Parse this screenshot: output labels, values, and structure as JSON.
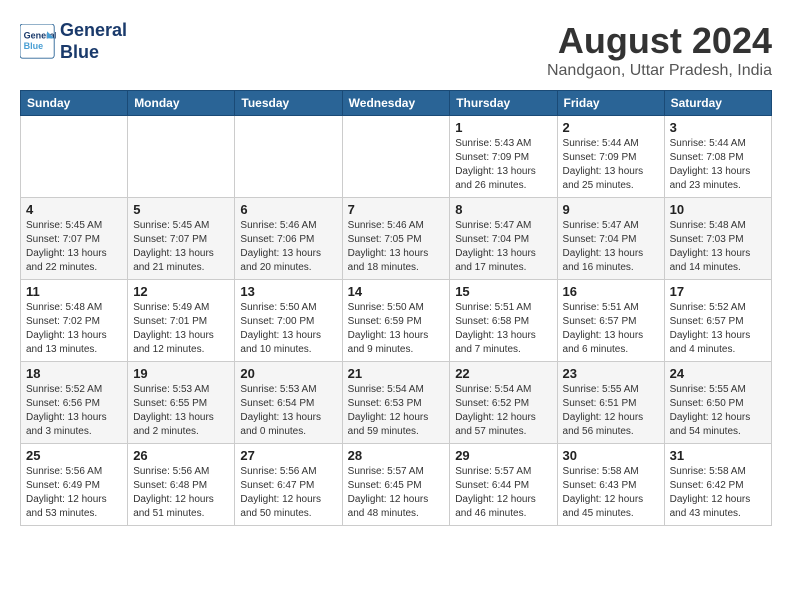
{
  "header": {
    "logo_line1": "General",
    "logo_line2": "Blue",
    "month_year": "August 2024",
    "location": "Nandgaon, Uttar Pradesh, India"
  },
  "weekdays": [
    "Sunday",
    "Monday",
    "Tuesday",
    "Wednesday",
    "Thursday",
    "Friday",
    "Saturday"
  ],
  "weeks": [
    [
      {
        "day": "",
        "info": ""
      },
      {
        "day": "",
        "info": ""
      },
      {
        "day": "",
        "info": ""
      },
      {
        "day": "",
        "info": ""
      },
      {
        "day": "1",
        "info": "Sunrise: 5:43 AM\nSunset: 7:09 PM\nDaylight: 13 hours and 26 minutes."
      },
      {
        "day": "2",
        "info": "Sunrise: 5:44 AM\nSunset: 7:09 PM\nDaylight: 13 hours and 25 minutes."
      },
      {
        "day": "3",
        "info": "Sunrise: 5:44 AM\nSunset: 7:08 PM\nDaylight: 13 hours and 23 minutes."
      }
    ],
    [
      {
        "day": "4",
        "info": "Sunrise: 5:45 AM\nSunset: 7:07 PM\nDaylight: 13 hours and 22 minutes."
      },
      {
        "day": "5",
        "info": "Sunrise: 5:45 AM\nSunset: 7:07 PM\nDaylight: 13 hours and 21 minutes."
      },
      {
        "day": "6",
        "info": "Sunrise: 5:46 AM\nSunset: 7:06 PM\nDaylight: 13 hours and 20 minutes."
      },
      {
        "day": "7",
        "info": "Sunrise: 5:46 AM\nSunset: 7:05 PM\nDaylight: 13 hours and 18 minutes."
      },
      {
        "day": "8",
        "info": "Sunrise: 5:47 AM\nSunset: 7:04 PM\nDaylight: 13 hours and 17 minutes."
      },
      {
        "day": "9",
        "info": "Sunrise: 5:47 AM\nSunset: 7:04 PM\nDaylight: 13 hours and 16 minutes."
      },
      {
        "day": "10",
        "info": "Sunrise: 5:48 AM\nSunset: 7:03 PM\nDaylight: 13 hours and 14 minutes."
      }
    ],
    [
      {
        "day": "11",
        "info": "Sunrise: 5:48 AM\nSunset: 7:02 PM\nDaylight: 13 hours and 13 minutes."
      },
      {
        "day": "12",
        "info": "Sunrise: 5:49 AM\nSunset: 7:01 PM\nDaylight: 13 hours and 12 minutes."
      },
      {
        "day": "13",
        "info": "Sunrise: 5:50 AM\nSunset: 7:00 PM\nDaylight: 13 hours and 10 minutes."
      },
      {
        "day": "14",
        "info": "Sunrise: 5:50 AM\nSunset: 6:59 PM\nDaylight: 13 hours and 9 minutes."
      },
      {
        "day": "15",
        "info": "Sunrise: 5:51 AM\nSunset: 6:58 PM\nDaylight: 13 hours and 7 minutes."
      },
      {
        "day": "16",
        "info": "Sunrise: 5:51 AM\nSunset: 6:57 PM\nDaylight: 13 hours and 6 minutes."
      },
      {
        "day": "17",
        "info": "Sunrise: 5:52 AM\nSunset: 6:57 PM\nDaylight: 13 hours and 4 minutes."
      }
    ],
    [
      {
        "day": "18",
        "info": "Sunrise: 5:52 AM\nSunset: 6:56 PM\nDaylight: 13 hours and 3 minutes."
      },
      {
        "day": "19",
        "info": "Sunrise: 5:53 AM\nSunset: 6:55 PM\nDaylight: 13 hours and 2 minutes."
      },
      {
        "day": "20",
        "info": "Sunrise: 5:53 AM\nSunset: 6:54 PM\nDaylight: 13 hours and 0 minutes."
      },
      {
        "day": "21",
        "info": "Sunrise: 5:54 AM\nSunset: 6:53 PM\nDaylight: 12 hours and 59 minutes."
      },
      {
        "day": "22",
        "info": "Sunrise: 5:54 AM\nSunset: 6:52 PM\nDaylight: 12 hours and 57 minutes."
      },
      {
        "day": "23",
        "info": "Sunrise: 5:55 AM\nSunset: 6:51 PM\nDaylight: 12 hours and 56 minutes."
      },
      {
        "day": "24",
        "info": "Sunrise: 5:55 AM\nSunset: 6:50 PM\nDaylight: 12 hours and 54 minutes."
      }
    ],
    [
      {
        "day": "25",
        "info": "Sunrise: 5:56 AM\nSunset: 6:49 PM\nDaylight: 12 hours and 53 minutes."
      },
      {
        "day": "26",
        "info": "Sunrise: 5:56 AM\nSunset: 6:48 PM\nDaylight: 12 hours and 51 minutes."
      },
      {
        "day": "27",
        "info": "Sunrise: 5:56 AM\nSunset: 6:47 PM\nDaylight: 12 hours and 50 minutes."
      },
      {
        "day": "28",
        "info": "Sunrise: 5:57 AM\nSunset: 6:45 PM\nDaylight: 12 hours and 48 minutes."
      },
      {
        "day": "29",
        "info": "Sunrise: 5:57 AM\nSunset: 6:44 PM\nDaylight: 12 hours and 46 minutes."
      },
      {
        "day": "30",
        "info": "Sunrise: 5:58 AM\nSunset: 6:43 PM\nDaylight: 12 hours and 45 minutes."
      },
      {
        "day": "31",
        "info": "Sunrise: 5:58 AM\nSunset: 6:42 PM\nDaylight: 12 hours and 43 minutes."
      }
    ]
  ]
}
